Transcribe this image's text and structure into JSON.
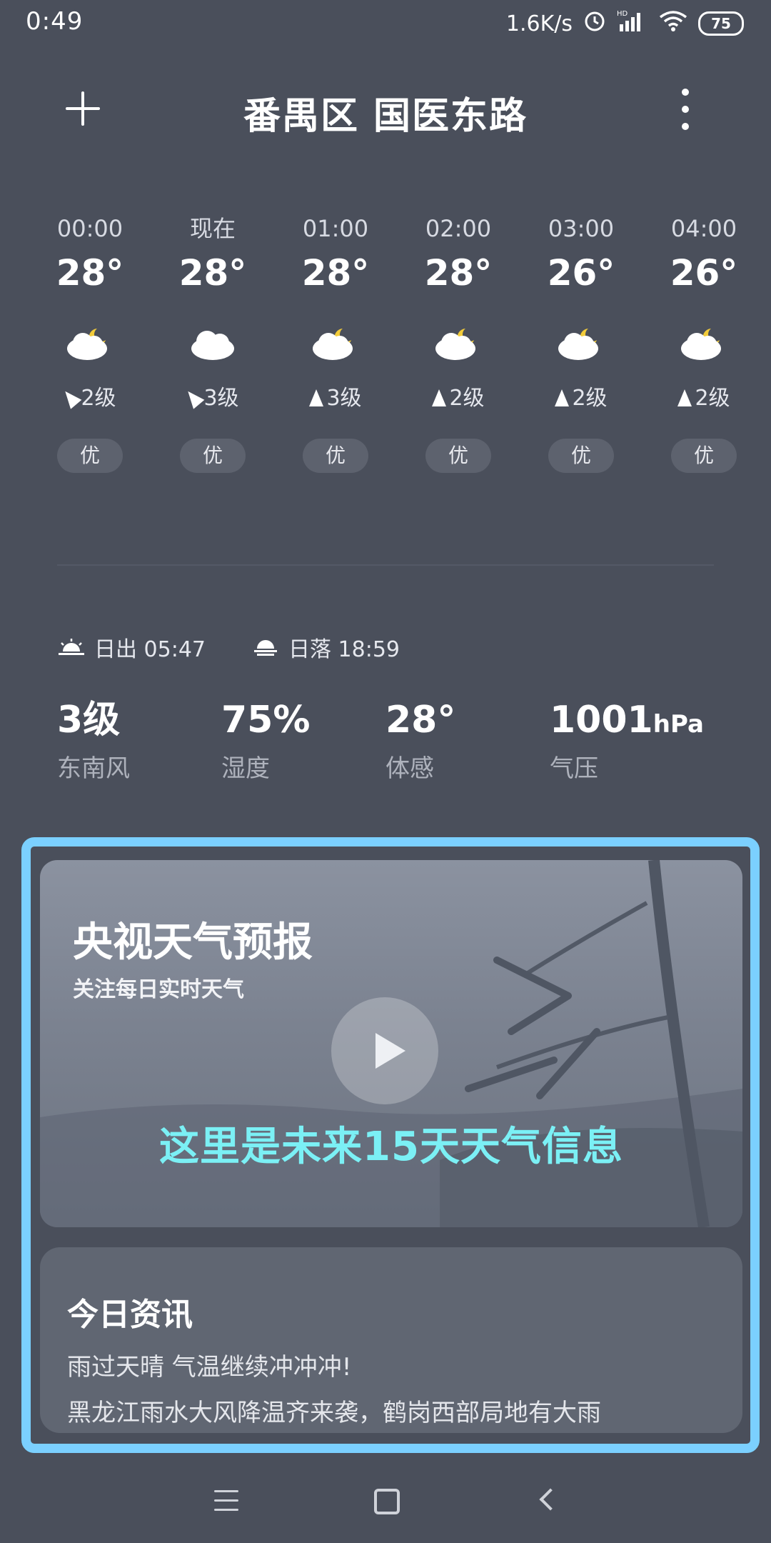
{
  "status": {
    "time": "0:49",
    "net_speed": "1.6K/s",
    "battery": "75",
    "hd_label": "HD",
    "icons": [
      "alarm-icon",
      "signal-icon",
      "wifi-icon",
      "battery-icon"
    ]
  },
  "header": {
    "title": "番禺区 国医东路",
    "add_icon": "plus-icon",
    "more_icon": "more-vertical-icon"
  },
  "hourly": [
    {
      "time": "00:00",
      "temp": "28°",
      "icon": "partly-cloudy-night-icon",
      "wind": "2级",
      "wind_dir": "northeast",
      "aqi": "优"
    },
    {
      "time": "现在",
      "temp": "28°",
      "icon": "cloudy-icon",
      "wind": "3级",
      "wind_dir": "northeast",
      "aqi": "优"
    },
    {
      "time": "01:00",
      "temp": "28°",
      "icon": "partly-cloudy-night-icon",
      "wind": "3级",
      "wind_dir": "north",
      "aqi": "优"
    },
    {
      "time": "02:00",
      "temp": "28°",
      "icon": "partly-cloudy-night-icon",
      "wind": "2级",
      "wind_dir": "north",
      "aqi": "优"
    },
    {
      "time": "03:00",
      "temp": "26°",
      "icon": "partly-cloudy-night-icon",
      "wind": "2级",
      "wind_dir": "north",
      "aqi": "优"
    },
    {
      "time": "04:00",
      "temp": "26°",
      "icon": "partly-cloudy-night-icon",
      "wind": "2级",
      "wind_dir": "north",
      "aqi": "优"
    }
  ],
  "sun": {
    "sunrise_label": "日出 05:47",
    "sunset_label": "日落 18:59"
  },
  "stats": [
    {
      "value": "3级",
      "unit": "",
      "label": "东南风"
    },
    {
      "value": "75%",
      "unit": "",
      "label": "湿度"
    },
    {
      "value": "28°",
      "unit": "",
      "label": "体感"
    },
    {
      "value": "1001",
      "unit": "hPa",
      "label": "气压"
    }
  ],
  "video": {
    "title": "央视天气预报",
    "subtitle": "关注每日实时天气",
    "banner": "这里是未来15天天气信息"
  },
  "news": {
    "title": "今日资讯",
    "items": [
      "雨过天晴 气温继续冲冲冲!",
      "黑龙江雨水大风降温齐来袭，鹤岗西部局地有大雨"
    ]
  },
  "colors": {
    "background": "#4a4f5b",
    "highlight": "#7bd0ff",
    "banner_text": "#7bf0f5"
  }
}
